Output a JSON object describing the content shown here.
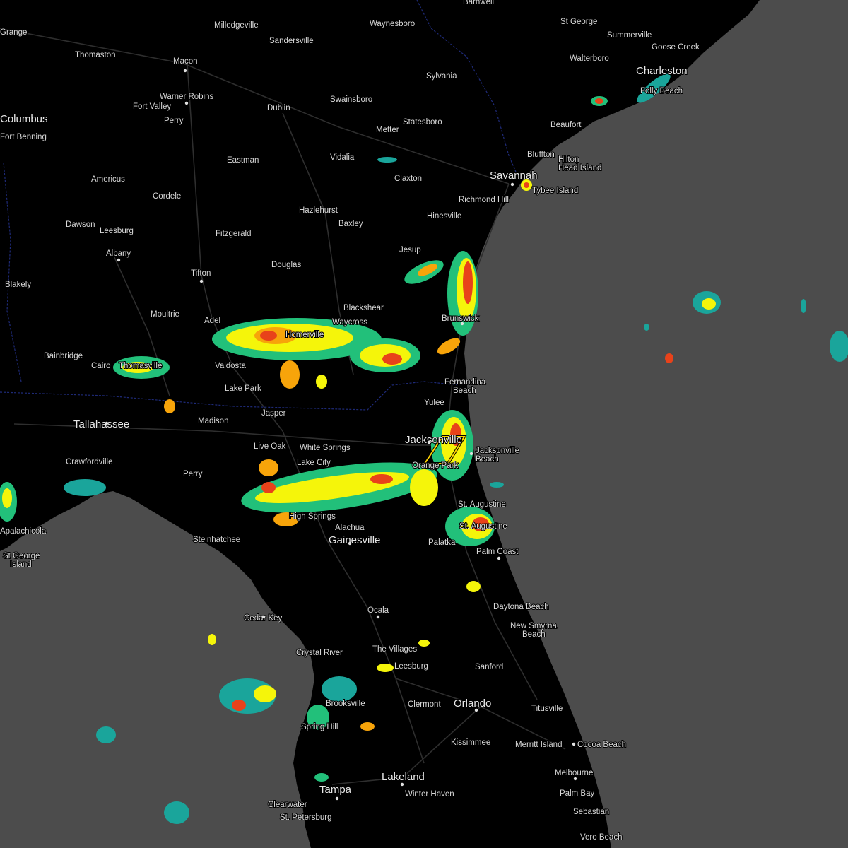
{
  "colors": {
    "ocean": "#4c4c4c",
    "land": "#000000",
    "roads": "#2e2e2e",
    "border": "#1e2a78",
    "warning_polygon": "#ffd400"
  },
  "radar_echo_colors": [
    "#1aa59b",
    "#22c07a",
    "#8be03a",
    "#f5f50a",
    "#f7a40a",
    "#e8421a"
  ],
  "cities": [
    {
      "name": "Grange"
    },
    {
      "name": "Milledgeville"
    },
    {
      "name": "Sandersville"
    },
    {
      "name": "Waynesboro"
    },
    {
      "name": "Barnwell"
    },
    {
      "name": "St George"
    },
    {
      "name": "Summerville"
    },
    {
      "name": "Goose Creek"
    },
    {
      "name": "Walterboro"
    },
    {
      "name": "Thomaston"
    },
    {
      "name": "Macon"
    },
    {
      "name": "Sylvania"
    },
    {
      "name": "Charleston"
    },
    {
      "name": "Folly Beach"
    },
    {
      "name": "Warner Robins"
    },
    {
      "name": "Swainsboro"
    },
    {
      "name": "Fort Valley"
    },
    {
      "name": "Dublin"
    },
    {
      "name": "Columbus"
    },
    {
      "name": "Perry"
    },
    {
      "name": "Statesboro"
    },
    {
      "name": "Fort Benning"
    },
    {
      "name": "Metter"
    },
    {
      "name": "Beaufort"
    },
    {
      "name": "Bluffton"
    },
    {
      "name": "Hilton Head Island"
    },
    {
      "name": "Eastman"
    },
    {
      "name": "Vidalia"
    },
    {
      "name": "Savannah"
    },
    {
      "name": "Claxton"
    },
    {
      "name": "Americus"
    },
    {
      "name": "Tybee Island"
    },
    {
      "name": "Cordele"
    },
    {
      "name": "Richmond Hill"
    },
    {
      "name": "Hazlehurst"
    },
    {
      "name": "Hinesville"
    },
    {
      "name": "Dawson"
    },
    {
      "name": "Leesburg"
    },
    {
      "name": "Baxley"
    },
    {
      "name": "Fitzgerald"
    },
    {
      "name": "Albany"
    },
    {
      "name": "Jesup"
    },
    {
      "name": "Douglas"
    },
    {
      "name": "Tifton"
    },
    {
      "name": "Blakely"
    },
    {
      "name": "Blackshear"
    },
    {
      "name": "Moultrie"
    },
    {
      "name": "Brunswick"
    },
    {
      "name": "Adel"
    },
    {
      "name": "Waycross"
    },
    {
      "name": "Homerville"
    },
    {
      "name": "Bainbridge"
    },
    {
      "name": "Cairo"
    },
    {
      "name": "Thomasville"
    },
    {
      "name": "Valdosta"
    },
    {
      "name": "Fernandina Beach"
    },
    {
      "name": "Lake Park"
    },
    {
      "name": "Yulee"
    },
    {
      "name": "Jasper"
    },
    {
      "name": "Tallahassee"
    },
    {
      "name": "Madison"
    },
    {
      "name": "Live Oak"
    },
    {
      "name": "White Springs"
    },
    {
      "name": "Jacksonville"
    },
    {
      "name": "Jacksonville Beach"
    },
    {
      "name": "Crawfordville"
    },
    {
      "name": "Lake City"
    },
    {
      "name": "Orange Park"
    },
    {
      "name": "Perry"
    },
    {
      "name": "St. Augustine"
    },
    {
      "name": "High Springs"
    },
    {
      "name": "Alachua"
    },
    {
      "name": "Apalachicola"
    },
    {
      "name": "Steinhatchee"
    },
    {
      "name": "Gainesville"
    },
    {
      "name": "Palatka"
    },
    {
      "name": "St. Augustine Beach"
    },
    {
      "name": "Palm Coast"
    },
    {
      "name": "St George Island"
    },
    {
      "name": "Daytona Beach"
    },
    {
      "name": "Ocala"
    },
    {
      "name": "Cedar Key"
    },
    {
      "name": "New Smyrna Beach"
    },
    {
      "name": "The Villages"
    },
    {
      "name": "Crystal River"
    },
    {
      "name": "Leesburg"
    },
    {
      "name": "Sanford"
    },
    {
      "name": "Clermont"
    },
    {
      "name": "Orlando"
    },
    {
      "name": "Brooksville"
    },
    {
      "name": "Titusville"
    },
    {
      "name": "Spring Hill"
    },
    {
      "name": "Kissimmee"
    },
    {
      "name": "Merritt Island"
    },
    {
      "name": "Cocoa Beach"
    },
    {
      "name": "Melbourne"
    },
    {
      "name": "Lakeland"
    },
    {
      "name": "Tampa"
    },
    {
      "name": "Palm Bay"
    },
    {
      "name": "Winter Haven"
    },
    {
      "name": "Clearwater"
    },
    {
      "name": "St. Petersburg"
    },
    {
      "name": "Sebastian"
    },
    {
      "name": "Vero Beach"
    }
  ],
  "labels": {
    "grange": "Grange",
    "milledgeville": "Milledgeville",
    "sandersville": "Sandersville",
    "waynesboro": "Waynesboro",
    "barnwell": "Barnwell",
    "stgeorge_sc": "St George",
    "summerville": "Summerville",
    "goosecreek": "Goose Creek",
    "walterboro": "Walterboro",
    "thomaston": "Thomaston",
    "macon": "Macon",
    "sylvania": "Sylvania",
    "charleston": "Charleston",
    "follybeach": "Folly Beach",
    "warnerrobins": "Warner Robins",
    "swainsboro": "Swainsboro",
    "fortvalley": "Fort Valley",
    "dublin": "Dublin",
    "columbus": "Columbus",
    "perry_ga": "Perry",
    "statesboro": "Statesboro",
    "fortbenning": "Fort Benning",
    "metter": "Metter",
    "beaufort": "Beaufort",
    "bluffton": "Bluffton",
    "hiltonhead1": "Hilton",
    "hiltonhead2": "Head Island",
    "eastman": "Eastman",
    "vidalia": "Vidalia",
    "savannah": "Savannah",
    "claxton": "Claxton",
    "americus": "Americus",
    "tybee": "Tybee Island",
    "cordele": "Cordele",
    "richmondhill": "Richmond Hill",
    "hazlehurst": "Hazlehurst",
    "hinesville": "Hinesville",
    "dawson": "Dawson",
    "leesburg_ga": "Leesburg",
    "baxley": "Baxley",
    "fitzgerald": "Fitzgerald",
    "albany": "Albany",
    "jesup": "Jesup",
    "douglas": "Douglas",
    "tifton": "Tifton",
    "blakely": "Blakely",
    "blackshear": "Blackshear",
    "moultrie": "Moultrie",
    "brunswick": "Brunswick",
    "adel": "Adel",
    "waycross": "Waycross",
    "homerville": "Homerville",
    "bainbridge": "Bainbridge",
    "cairo": "Cairo",
    "thomasville": "Thomasville",
    "valdosta": "Valdosta",
    "fernandina1": "Fernandina",
    "fernandina2": "Beach",
    "lakepark": "Lake Park",
    "yulee": "Yulee",
    "jasper": "Jasper",
    "tallahassee": "Tallahassee",
    "madison": "Madison",
    "liveoak": "Live Oak",
    "whitesprings": "White Springs",
    "jacksonville": "Jacksonville",
    "jaxbeach1": "Jacksonville",
    "jaxbeach2": "Beach",
    "crawfordville": "Crawfordville",
    "lakecity": "Lake City",
    "orangepark": "Orange Park",
    "perry_fl": "Perry",
    "staugustine": "St. Augustine",
    "highsprings": "High Springs",
    "alachua": "Alachua",
    "apalachicola": "Apalachicola",
    "steinhatchee": "Steinhatchee",
    "gainesville": "Gainesville",
    "palatka": "Palatka",
    "staugbeach": "St. Augustine",
    "palmcoast": "Palm Coast",
    "stgeorgeisland1": "St George",
    "stgeorgeisland2": "Island",
    "daytona": "Daytona Beach",
    "ocala": "Ocala",
    "cedarkey": "Cedar Key",
    "newsmyrna1": "New Smyrna",
    "newsmyrna2": "Beach",
    "villages": "The Villages",
    "crystalriver": "Crystal River",
    "leesburg_fl": "Leesburg",
    "sanford": "Sanford",
    "clermont": "Clermont",
    "orlando": "Orlando",
    "brooksville": "Brooksville",
    "titusville": "Titusville",
    "springhill": "Spring Hill",
    "kissimmee": "Kissimmee",
    "merrittisland": "Merritt Island",
    "cocoabeach": "Cocoa Beach",
    "melbourne": "Melbourne",
    "lakeland": "Lakeland",
    "tampa": "Tampa",
    "palmbay": "Palm Bay",
    "winterhaven": "Winter Haven",
    "clearwater": "Clearwater",
    "stpete": "St. Petersburg",
    "sebastian": "Sebastian",
    "verobeach": "Vero Beach"
  }
}
